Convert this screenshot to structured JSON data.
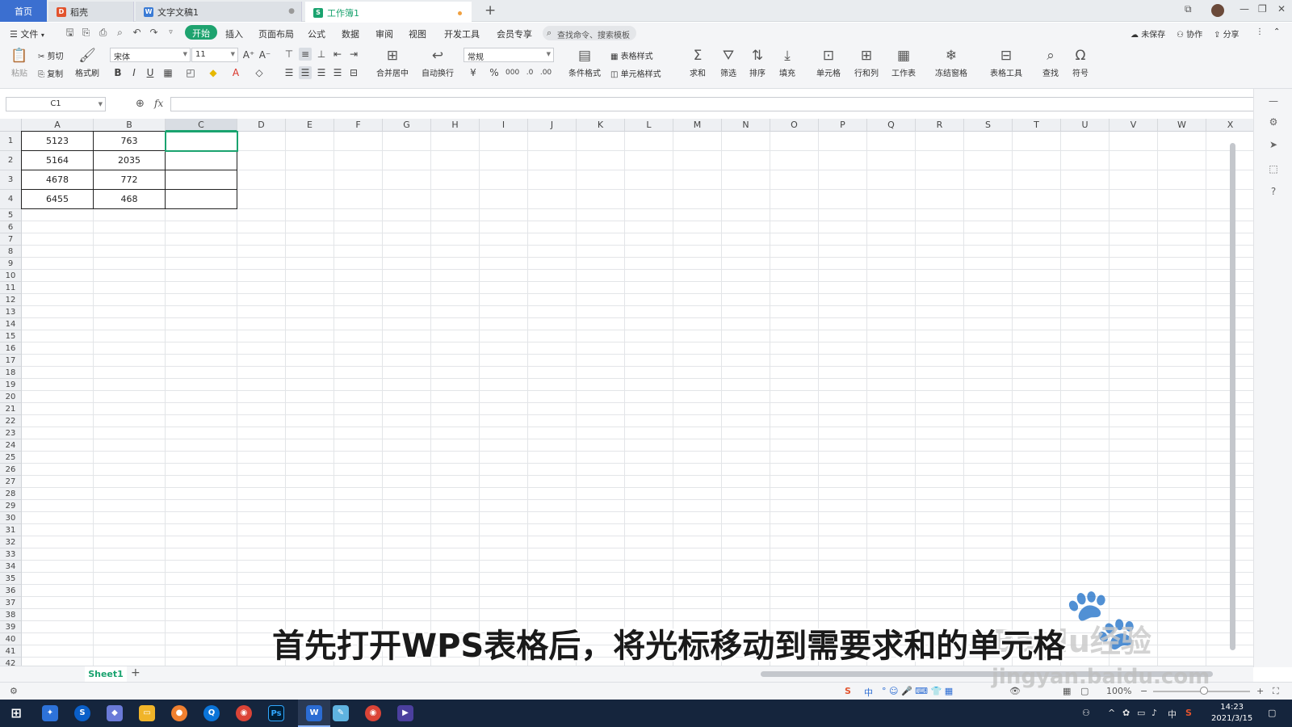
{
  "titlebar": {
    "home_tab": "首页",
    "tabs": [
      {
        "label": "稻壳",
        "icon": "daoke-icon"
      },
      {
        "label": "文字文稿1",
        "icon": "wps-writer-icon"
      },
      {
        "label": "工作簿1",
        "icon": "wps-sheet-icon"
      }
    ],
    "new_tab": "+"
  },
  "menubar": {
    "file": "文件",
    "items": [
      "开始",
      "插入",
      "页面布局",
      "公式",
      "数据",
      "审阅",
      "视图",
      "开发工具",
      "会员专享"
    ],
    "search_placeholder": "查找命令、搜索模板",
    "unsaved": "未保存",
    "collab": "协作",
    "share": "分享"
  },
  "ribbon": {
    "paste": "粘贴",
    "cut": "剪切",
    "copy": "复制",
    "format_painter": "格式刷",
    "font_name": "宋体",
    "font_size": "11",
    "merge_center": "合并居中",
    "wrap_text": "自动换行",
    "number_format": "常规",
    "conditional_format": "条件格式",
    "table_style": "表格样式",
    "cell_style": "单元格样式",
    "sum": "求和",
    "filter": "筛选",
    "sort": "排序",
    "fill": "填充",
    "cells": "单元格",
    "rows_cols": "行和列",
    "worksheet": "工作表",
    "freeze_panes": "冻结窗格",
    "table_tools": "表格工具",
    "find": "查找",
    "symbol": "符号"
  },
  "formula_bar": {
    "name_box": "C1",
    "fx": "fx",
    "formula": ""
  },
  "grid": {
    "columns": [
      "A",
      "B",
      "C",
      "D",
      "E",
      "F",
      "G",
      "H",
      "I",
      "J",
      "K",
      "L",
      "M",
      "N",
      "O",
      "P",
      "Q",
      "R",
      "S",
      "T",
      "U",
      "V",
      "W",
      "X"
    ],
    "rows": [
      "1",
      "2",
      "3",
      "4",
      "5",
      "6",
      "7",
      "8",
      "9",
      "10",
      "11",
      "12",
      "13",
      "14",
      "15",
      "16",
      "17",
      "18",
      "19",
      "20",
      "21",
      "22",
      "23",
      "24",
      "25",
      "26",
      "27",
      "28",
      "29",
      "30",
      "31",
      "32",
      "33",
      "34",
      "35",
      "36",
      "37",
      "38",
      "39",
      "40",
      "41",
      "42"
    ],
    "active_column": "C",
    "active_cell": "C1",
    "data": [
      [
        "5123",
        "763",
        ""
      ],
      [
        "5164",
        "2035",
        ""
      ],
      [
        "4678",
        "772",
        ""
      ],
      [
        "6455",
        "468",
        ""
      ]
    ]
  },
  "sheets": {
    "tabs": [
      "Sheet1"
    ],
    "add": "+"
  },
  "status": {
    "zoom": "100%"
  },
  "subtitle": "首先打开WPS表格后，将光标移动到需要求和的单元格",
  "watermark": {
    "brand": "Baidu经验",
    "url": "jingyan.baidu.com"
  },
  "taskbar": {
    "time": "14:23",
    "date": "2021/3/15",
    "ime": "中"
  },
  "colors": {
    "accent": "#1aa36f",
    "home_tab": "#3b6fd0",
    "taskbar": "#15253d"
  }
}
